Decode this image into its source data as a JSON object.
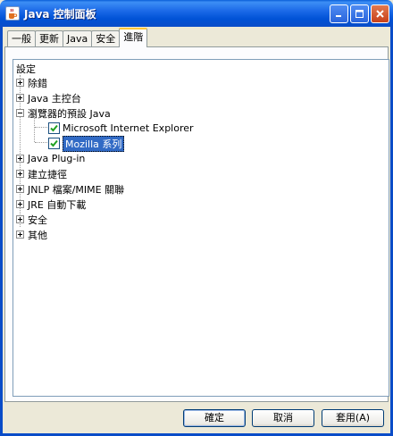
{
  "window": {
    "title": "Java 控制面板",
    "icon": "java-cup-icon"
  },
  "tabs": [
    {
      "label": "一般",
      "active": false
    },
    {
      "label": "更新",
      "active": false
    },
    {
      "label": "Java",
      "active": false
    },
    {
      "label": "安全",
      "active": false
    },
    {
      "label": "進階",
      "active": true
    }
  ],
  "tree": {
    "root_label": "設定",
    "items": [
      {
        "label": "除錯",
        "state": "collapsed"
      },
      {
        "label": "Java 主控台",
        "state": "collapsed"
      },
      {
        "label": "瀏覽器的預設 Java",
        "state": "expanded",
        "children": [
          {
            "label": "Microsoft Internet Explorer",
            "checked": true,
            "selected": false
          },
          {
            "label": "Mozilla 系列",
            "checked": true,
            "selected": true
          }
        ]
      },
      {
        "label": "Java Plug-in",
        "state": "collapsed"
      },
      {
        "label": "建立捷徑",
        "state": "collapsed"
      },
      {
        "label": "JNLP 檔案/MIME 關聯",
        "state": "collapsed"
      },
      {
        "label": "JRE 自動下載",
        "state": "collapsed"
      },
      {
        "label": "安全",
        "state": "collapsed"
      },
      {
        "label": "其他",
        "state": "collapsed"
      }
    ]
  },
  "buttons": {
    "ok": "確定",
    "cancel": "取消",
    "apply": "套用(A)"
  }
}
